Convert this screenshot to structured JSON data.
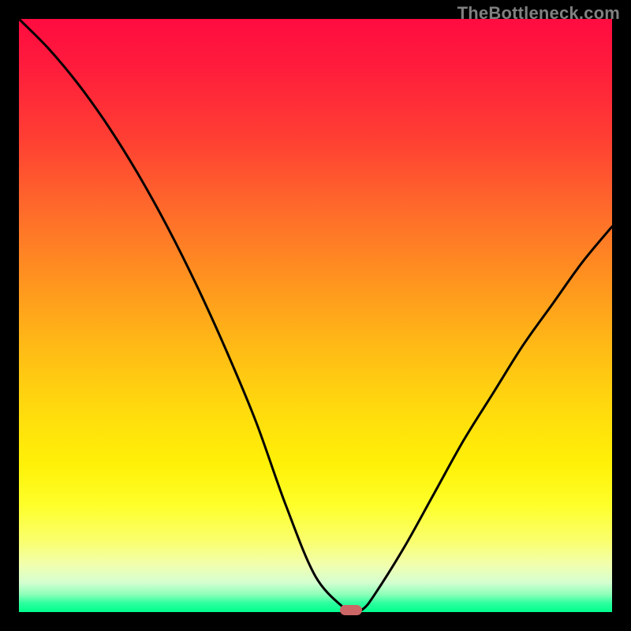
{
  "watermark": "TheBottleneck.com",
  "chart_data": {
    "type": "line",
    "title": "",
    "xlabel": "",
    "ylabel": "",
    "xlim": [
      0,
      100
    ],
    "ylim": [
      0,
      100
    ],
    "grid": false,
    "legend": false,
    "series": [
      {
        "name": "bottleneck-curve",
        "x": [
          0,
          5,
          10,
          15,
          20,
          25,
          30,
          35,
          40,
          45,
          50,
          55,
          56,
          58,
          60,
          65,
          70,
          75,
          80,
          85,
          90,
          95,
          100
        ],
        "values": [
          100,
          95,
          89,
          82,
          74,
          65,
          55,
          44,
          32,
          18,
          6,
          0.5,
          0,
          0.5,
          3,
          11,
          20,
          29,
          37,
          45,
          52,
          59,
          65
        ]
      }
    ],
    "marker": {
      "x": 56,
      "y": 0,
      "color": "#cc6666"
    },
    "background_gradient": {
      "top": "#ff0b40",
      "bottom": "#00ff8e",
      "meaning": "high-to-low bottleneck (red high, green low)"
    }
  }
}
